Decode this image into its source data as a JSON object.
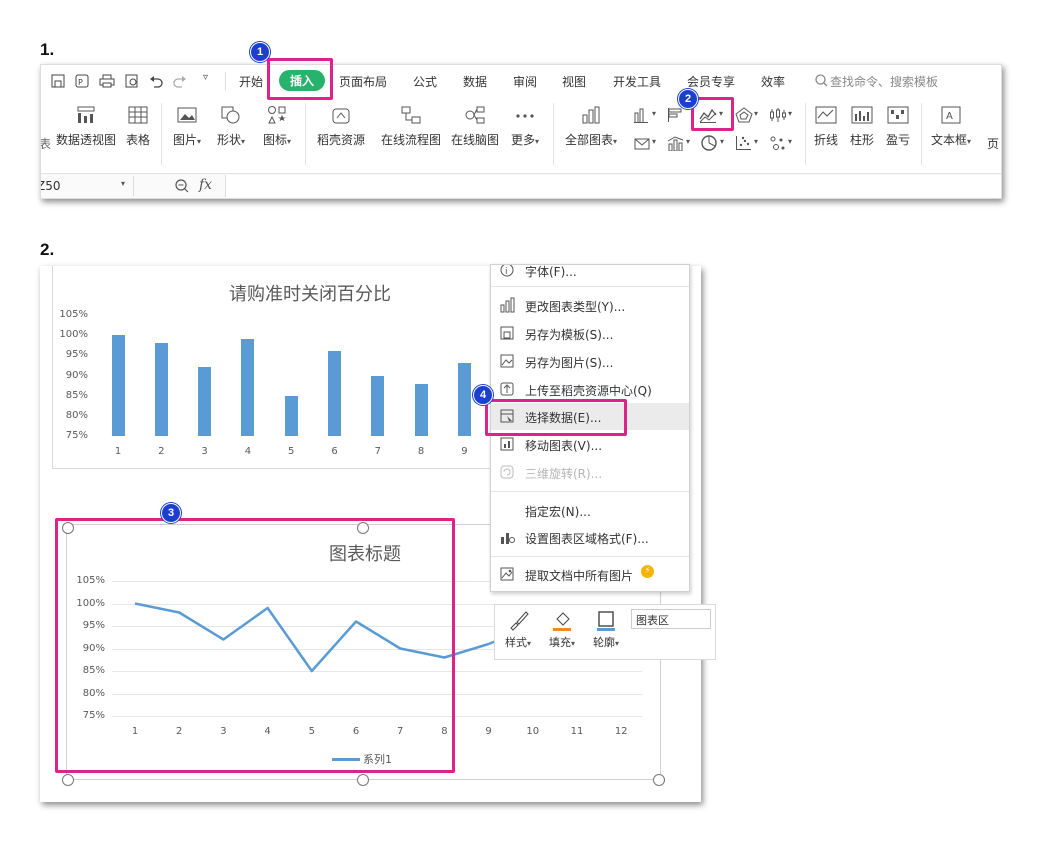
{
  "steps": {
    "s1": "1.",
    "s2": "2."
  },
  "badges": {
    "b1": "1",
    "b2": "2",
    "b3": "3",
    "b4": "4"
  },
  "ribbon_tabs": [
    "开始",
    "插入",
    "页面布局",
    "公式",
    "数据",
    "审阅",
    "视图",
    "开发工具",
    "会员专享",
    "效率"
  ],
  "active_tab": "插入",
  "search_placeholder": "查找命令、搜索模板",
  "ribbon_items": {
    "pivot": "数据透视图",
    "table": "表格",
    "picture": "图片",
    "shape": "形状",
    "icon": "图标",
    "resource": "稻壳资源",
    "flowchart": "在线流程图",
    "mindmap": "在线脑图",
    "more": "更多",
    "all_charts": "全部图表",
    "sparkline_line": "折线",
    "sparkline_col": "柱形",
    "sparkline_wl": "盈亏",
    "textbox": "文本框",
    "page": "页"
  },
  "left_clip": "表",
  "name_box": "Z50",
  "fx": "fx",
  "chart1": {
    "title": "请购准时关闭百分比",
    "y_ticks": [
      "105%",
      "100%",
      "95%",
      "90%",
      "85%",
      "80%",
      "75%"
    ],
    "x_ticks": [
      "1",
      "2",
      "3",
      "4",
      "5",
      "6",
      "7",
      "8",
      "9"
    ]
  },
  "chart2": {
    "title": "图表标题",
    "y_ticks": [
      "105%",
      "100%",
      "95%",
      "90%",
      "85%",
      "80%",
      "75%"
    ],
    "x_ticks": [
      "1",
      "2",
      "3",
      "4",
      "5",
      "6",
      "7",
      "8",
      "9",
      "10",
      "11",
      "12"
    ],
    "legend": "系列1"
  },
  "chart_data": [
    {
      "type": "bar",
      "title": "请购准时关闭百分比",
      "categories": [
        "1",
        "2",
        "3",
        "4",
        "5",
        "6",
        "7",
        "8",
        "9"
      ],
      "values": [
        100,
        98,
        92,
        99,
        85,
        96,
        90,
        88,
        93
      ],
      "ylim": [
        75,
        105
      ],
      "grid": false,
      "color": "#5b9bd5"
    },
    {
      "type": "line",
      "title": "图表标题",
      "categories": [
        "1",
        "2",
        "3",
        "4",
        "5",
        "6",
        "7",
        "8",
        "9",
        "10",
        "11",
        "12"
      ],
      "series": [
        {
          "name": "系列1",
          "values": [
            100,
            98,
            92,
            99,
            85,
            96,
            90,
            88,
            91,
            95
          ]
        }
      ],
      "ylim": [
        75,
        105
      ],
      "grid": true,
      "legend": "bottom",
      "color": "#5b9bd5"
    }
  ],
  "context_menu": {
    "font": "字体(F)...",
    "change_type": "更改图表类型(Y)...",
    "save_template": "另存为模板(S)...",
    "save_picture": "另存为图片(S)...",
    "upload": "上传至稻壳资源中心(Q)",
    "select_data": "选择数据(E)...",
    "move_chart": "移动图表(V)...",
    "rotate_3d": "三维旋转(R)...",
    "assign_macro": "指定宏(N)...",
    "format_area": "设置图表区域格式(F)...",
    "extract_images": "提取文档中所有图片"
  },
  "mini_toolbar": {
    "style": "样式",
    "fill": "填充",
    "outline": "轮廓",
    "element": "图表区"
  },
  "colors": {
    "accent_green": "#27b36b",
    "highlight": "#e0218a",
    "badge_blue": "#1a3fd1",
    "series": "#5b9bd5"
  }
}
